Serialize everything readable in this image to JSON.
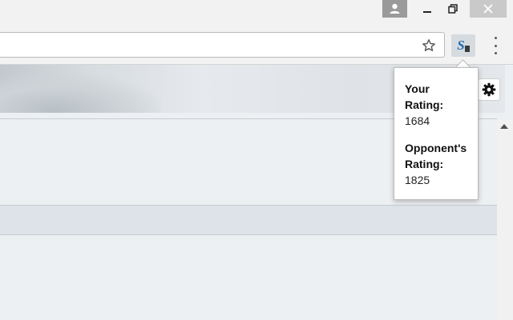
{
  "window": {
    "profile_icon": "person-icon",
    "minimize_icon": "minimize-icon",
    "restore_icon": "restore-icon",
    "close_icon": "close-icon"
  },
  "toolbar": {
    "bookmark_icon": "star-icon",
    "extension_logo": "S",
    "menu_icon": "kebab-menu-icon"
  },
  "page": {
    "settings_icon": "gear-icon"
  },
  "popup": {
    "your_rating_label_line1": "Your",
    "your_rating_label_line2": "Rating:",
    "your_rating_value": "1684",
    "opponent_rating_label_line1": "Opponent's",
    "opponent_rating_label_line2": "Rating:",
    "opponent_rating_value": "1825"
  },
  "colors": {
    "extension_blue": "#1f6fb2",
    "close_button_bg": "#c9c9c9",
    "profile_button_bg": "#9a9a9a"
  }
}
